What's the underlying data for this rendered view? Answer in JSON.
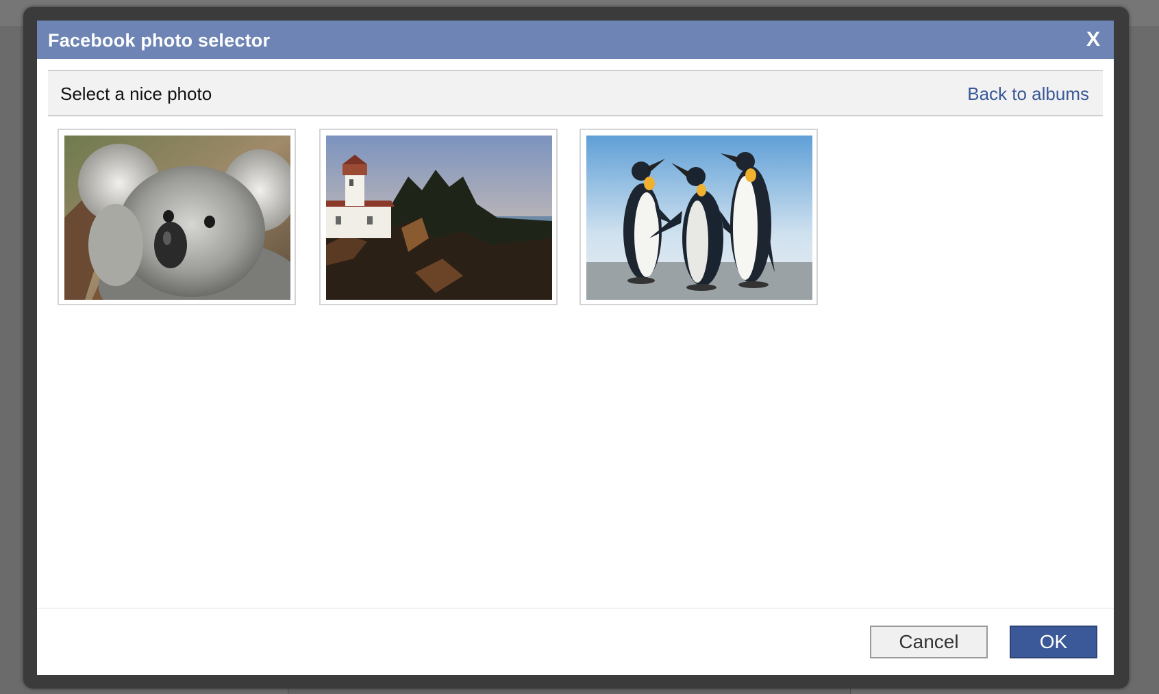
{
  "dialog": {
    "title": "Facebook photo selector",
    "close_label": "X"
  },
  "subheader": {
    "title": "Select a nice photo",
    "back_link": "Back to albums"
  },
  "photos": [
    {
      "name": "koala"
    },
    {
      "name": "lighthouse"
    },
    {
      "name": "penguins"
    }
  ],
  "footer": {
    "cancel_label": "Cancel",
    "ok_label": "OK"
  },
  "colors": {
    "titlebar": "#6d84b4",
    "link": "#3b5998",
    "ok_button": "#3b5998"
  }
}
